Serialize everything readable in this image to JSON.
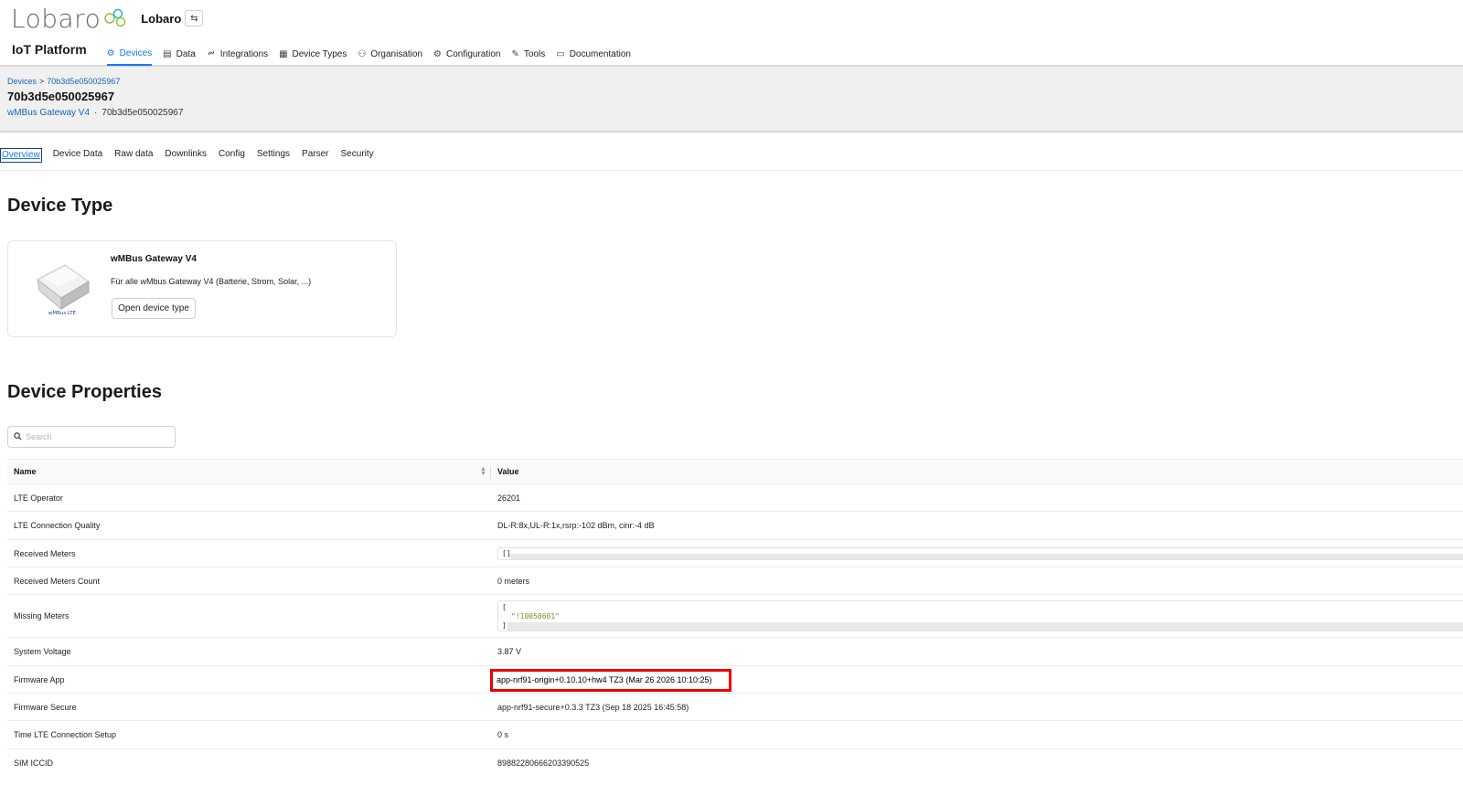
{
  "header": {
    "logo_text": "Lobaro",
    "org_name": "Lobaro",
    "org_switch_icon": "⇆",
    "platform": "IoT Platform",
    "nav": [
      {
        "label": "Devices",
        "icon": "gear-icon",
        "glyph": "⚙",
        "active": true
      },
      {
        "label": "Data",
        "icon": "table-icon",
        "glyph": "▤"
      },
      {
        "label": "Integrations",
        "icon": "link-icon",
        "glyph": "🔗"
      },
      {
        "label": "Device Types",
        "icon": "grid-icon",
        "glyph": "▦"
      },
      {
        "label": "Organisation",
        "icon": "team-icon",
        "glyph": "⚇"
      },
      {
        "label": "Configuration",
        "icon": "settings-icon",
        "glyph": "⚙"
      },
      {
        "label": "Tools",
        "icon": "tool-icon",
        "glyph": "✎"
      },
      {
        "label": "Documentation",
        "icon": "book-icon",
        "glyph": "▭"
      }
    ]
  },
  "page": {
    "breadcrumb": [
      "Devices",
      "70b3d5e050025967"
    ],
    "breadcrumb_sep": ">",
    "title": "70b3d5e050025967",
    "subtitle_link": "wMBus Gateway V4",
    "subtitle_dot": "·",
    "subtitle_id": "70b3d5e050025967"
  },
  "tabs": [
    "Overview",
    "Device Data",
    "Raw data",
    "Downlinks",
    "Config",
    "Settings",
    "Parser",
    "Security"
  ],
  "device_type": {
    "heading": "Device Type",
    "name": "wMBus Gateway V4",
    "description": "Für alle wMbus Gateway V4 (Batterie, Strom, Solar, ...)",
    "button": "Open device type",
    "image_caption": "wMBus LTE"
  },
  "properties": {
    "heading": "Device Properties",
    "search_placeholder": "Search",
    "col_name": "Name",
    "col_value": "Value",
    "rows": [
      {
        "name": "LTE Operator",
        "value": "26201"
      },
      {
        "name": "LTE Connection Quality",
        "value": "DL-R:8x,UL-R:1x,rsrp:-102 dBm, cinr:-4 dB"
      },
      {
        "name": "Received Meters",
        "value": "[]"
      },
      {
        "name": "Received Meters Count",
        "value": "0 meters"
      },
      {
        "name": "Missing Meters",
        "value_open": "[",
        "value_item": "\"!10058601\"",
        "value_close": "]"
      },
      {
        "name": "System Voltage",
        "value": "3.87 V"
      },
      {
        "name": "Firmware App",
        "value": "app-nrf91-origin+0.10.10+hw4 TZ3 (Mar 26 2026 10:10:25)"
      },
      {
        "name": "Firmware Secure",
        "value": "app-nrf91-secure+0.3.3 TZ3 (Sep 18 2025 16:45:58)"
      },
      {
        "name": "Time LTE Connection Setup",
        "value": "0 s"
      },
      {
        "name": "SIM ICCID",
        "value": "89882280666203390525"
      }
    ]
  },
  "colors": {
    "accent": "#1677ff",
    "link": "#1a63b8",
    "highlight": "#ee0000"
  }
}
